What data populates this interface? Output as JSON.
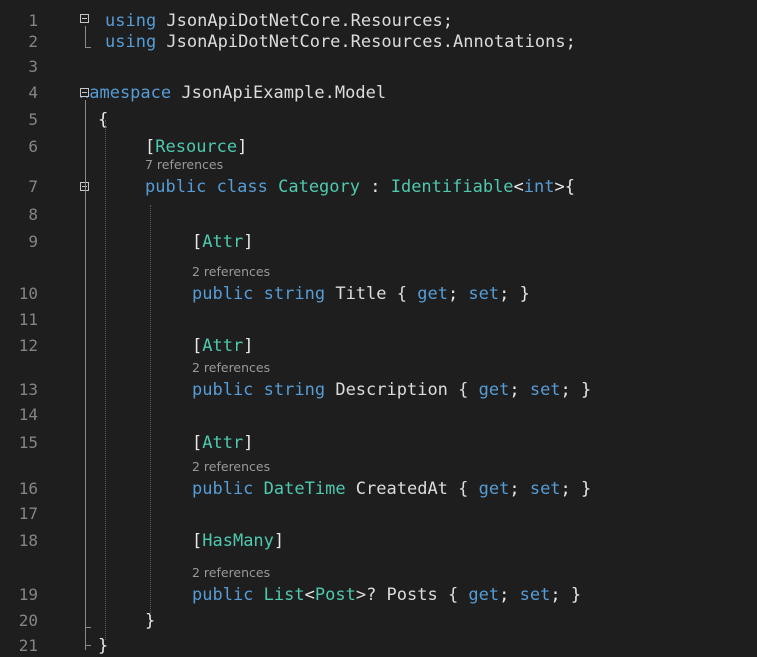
{
  "editor": {
    "lines": [
      {
        "n": "1",
        "tokens": [
          {
            "t": "using",
            "c": "kw"
          },
          {
            "t": " JsonApiDotNetCore.Resources;",
            "c": "id"
          }
        ]
      },
      {
        "n": "2",
        "tokens": [
          {
            "t": "using",
            "c": "kw"
          },
          {
            "t": " JsonApiDotNetCore.Resources.Annotations;",
            "c": "id"
          }
        ]
      },
      {
        "n": "3",
        "tokens": []
      },
      {
        "n": "4",
        "tokens": [
          {
            "t": "namespace",
            "c": "kw"
          },
          {
            "t": " JsonApiExample.Model",
            "c": "id"
          }
        ]
      },
      {
        "n": "5",
        "tokens": [
          {
            "t": "{",
            "c": "pl"
          }
        ]
      },
      {
        "n": "6",
        "tokens": [
          {
            "t": "[",
            "c": "pl"
          },
          {
            "t": "Resource",
            "c": "ty"
          },
          {
            "t": "]",
            "c": "pl"
          }
        ]
      },
      {
        "n": "7",
        "lens": "7 references",
        "tokens": [
          {
            "t": "public",
            "c": "kw"
          },
          {
            "t": " ",
            "c": "pl"
          },
          {
            "t": "class",
            "c": "kw"
          },
          {
            "t": " ",
            "c": "pl"
          },
          {
            "t": "Category",
            "c": "ty"
          },
          {
            "t": " : ",
            "c": "pl"
          },
          {
            "t": "Identifiable",
            "c": "ty"
          },
          {
            "t": "<",
            "c": "pl"
          },
          {
            "t": "int",
            "c": "kw"
          },
          {
            "t": ">{",
            "c": "pl"
          }
        ]
      },
      {
        "n": "8",
        "tokens": []
      },
      {
        "n": "9",
        "tokens": [
          {
            "t": "[",
            "c": "pl"
          },
          {
            "t": "Attr",
            "c": "ty"
          },
          {
            "t": "]",
            "c": "pl"
          }
        ]
      },
      {
        "n": "10",
        "lens": "2 references",
        "tokens": [
          {
            "t": "public",
            "c": "kw"
          },
          {
            "t": " ",
            "c": "pl"
          },
          {
            "t": "string",
            "c": "kw"
          },
          {
            "t": " Title { ",
            "c": "id"
          },
          {
            "t": "get",
            "c": "kw"
          },
          {
            "t": "; ",
            "c": "pl"
          },
          {
            "t": "set",
            "c": "kw"
          },
          {
            "t": "; }",
            "c": "pl"
          }
        ]
      },
      {
        "n": "11",
        "tokens": []
      },
      {
        "n": "12",
        "tokens": [
          {
            "t": "[",
            "c": "pl"
          },
          {
            "t": "Attr",
            "c": "ty"
          },
          {
            "t": "]",
            "c": "pl"
          }
        ]
      },
      {
        "n": "13",
        "lens": "2 references",
        "tokens": [
          {
            "t": "public",
            "c": "kw"
          },
          {
            "t": " ",
            "c": "pl"
          },
          {
            "t": "string",
            "c": "kw"
          },
          {
            "t": " Description { ",
            "c": "id"
          },
          {
            "t": "get",
            "c": "kw"
          },
          {
            "t": "; ",
            "c": "pl"
          },
          {
            "t": "set",
            "c": "kw"
          },
          {
            "t": "; }",
            "c": "pl"
          }
        ]
      },
      {
        "n": "14",
        "tokens": []
      },
      {
        "n": "15",
        "tokens": [
          {
            "t": "[",
            "c": "pl"
          },
          {
            "t": "Attr",
            "c": "ty"
          },
          {
            "t": "]",
            "c": "pl"
          }
        ]
      },
      {
        "n": "16",
        "lens": "2 references",
        "tokens": [
          {
            "t": "public",
            "c": "kw"
          },
          {
            "t": " ",
            "c": "pl"
          },
          {
            "t": "DateTime",
            "c": "ty"
          },
          {
            "t": " CreatedAt { ",
            "c": "id"
          },
          {
            "t": "get",
            "c": "kw"
          },
          {
            "t": "; ",
            "c": "pl"
          },
          {
            "t": "set",
            "c": "kw"
          },
          {
            "t": "; }",
            "c": "pl"
          }
        ]
      },
      {
        "n": "17",
        "tokens": []
      },
      {
        "n": "18",
        "tokens": [
          {
            "t": "[",
            "c": "pl"
          },
          {
            "t": "HasMany",
            "c": "ty"
          },
          {
            "t": "]",
            "c": "pl"
          }
        ]
      },
      {
        "n": "19",
        "lens": "2 references",
        "tokens": [
          {
            "t": "public",
            "c": "kw"
          },
          {
            "t": " ",
            "c": "pl"
          },
          {
            "t": "List",
            "c": "ty"
          },
          {
            "t": "<",
            "c": "pl"
          },
          {
            "t": "Post",
            "c": "ty"
          },
          {
            "t": ">? Posts { ",
            "c": "id"
          },
          {
            "t": "get",
            "c": "kw"
          },
          {
            "t": "; ",
            "c": "pl"
          },
          {
            "t": "set",
            "c": "kw"
          },
          {
            "t": "; }",
            "c": "pl"
          }
        ]
      },
      {
        "n": "20",
        "tokens": [
          {
            "t": "}",
            "c": "pl"
          }
        ]
      },
      {
        "n": "21",
        "tokens": [
          {
            "t": "}",
            "c": "pl"
          }
        ]
      }
    ],
    "colors": {
      "background": "#1e1e1e",
      "keyword": "#569cd6",
      "type": "#4ec9b0",
      "identifier": "#dcdcdc",
      "line_number": "#858585",
      "codelens": "#999999"
    }
  }
}
